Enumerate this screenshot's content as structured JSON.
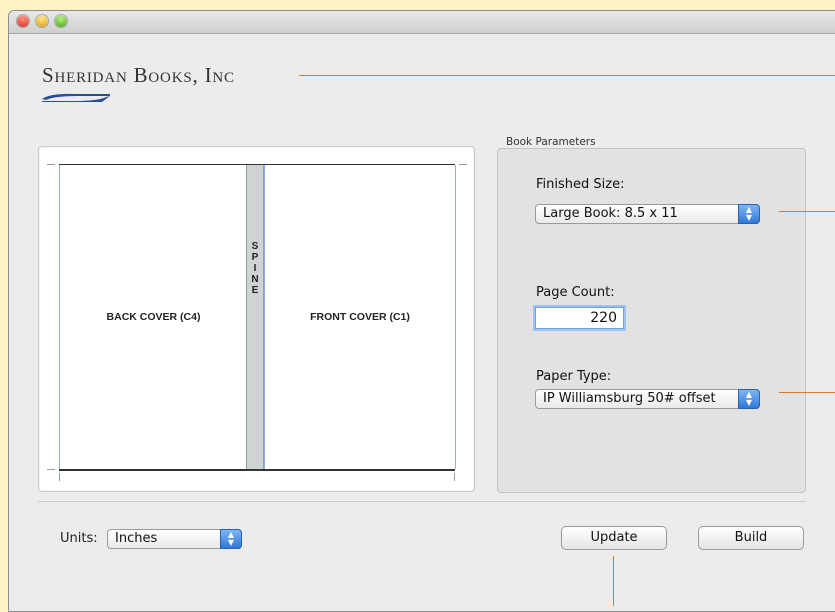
{
  "brand": {
    "name": "Sheridan Books, Inc"
  },
  "preview": {
    "back_label": "BACK COVER (C4)",
    "front_label": "FRONT COVER (C1)",
    "spine_label": "SPINE"
  },
  "params": {
    "group_label": "Book Parameters",
    "finished_size_label": "Finished Size:",
    "finished_size_value": "Large Book: 8.5 x 11",
    "page_count_label": "Page Count:",
    "page_count_value": "220",
    "paper_type_label": "Paper Type:",
    "paper_type_value": "IP Williamsburg 50# offset"
  },
  "footer": {
    "units_label": "Units:",
    "units_value": "Inches",
    "update_label": "Update",
    "build_label": "Build"
  },
  "colors": {
    "callout": "#e07a2a",
    "spine": "#cfd3d3",
    "accent": "#2f78d8",
    "background": "#fdf2c4"
  }
}
